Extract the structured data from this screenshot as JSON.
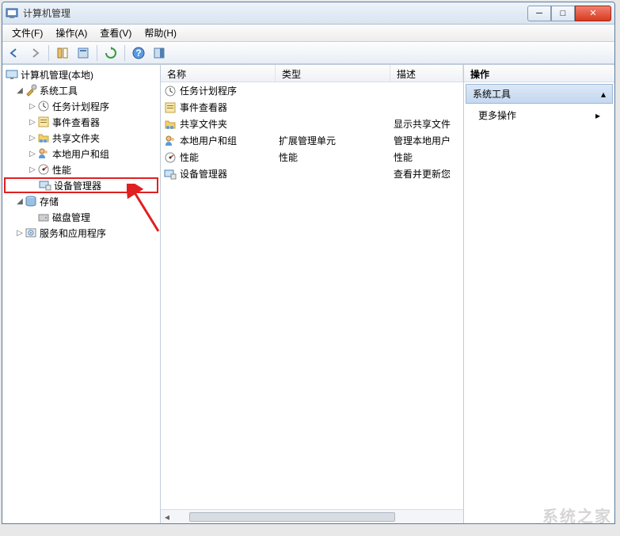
{
  "window": {
    "title": "计算机管理"
  },
  "menu": {
    "file": "文件(F)",
    "action": "操作(A)",
    "view": "查看(V)",
    "help": "帮助(H)"
  },
  "tree": {
    "root": "计算机管理(本地)",
    "sys_tools": "系统工具",
    "task_sched": "任务计划程序",
    "event_viewer": "事件查看器",
    "shared": "共享文件夹",
    "local_users": "本地用户和组",
    "perf": "性能",
    "device_mgr": "设备管理器",
    "storage": "存储",
    "disk_mgmt": "磁盘管理",
    "services": "服务和应用程序"
  },
  "list": {
    "cols": {
      "name": "名称",
      "type": "类型",
      "desc": "描述"
    },
    "col_widths": {
      "name": 145,
      "type": 145,
      "desc": 90
    },
    "rows": [
      {
        "icon": "clock",
        "name": "任务计划程序",
        "type": "",
        "desc": ""
      },
      {
        "icon": "event",
        "name": "事件查看器",
        "type": "",
        "desc": ""
      },
      {
        "icon": "folder",
        "name": "共享文件夹",
        "type": "",
        "desc": "显示共享文件"
      },
      {
        "icon": "users",
        "name": "本地用户和组",
        "type": "扩展管理单元",
        "desc": "管理本地用户"
      },
      {
        "icon": "perf",
        "name": "性能",
        "type": "性能",
        "desc": "性能"
      },
      {
        "icon": "device",
        "name": "设备管理器",
        "type": "",
        "desc": "查看并更新您"
      }
    ]
  },
  "actions": {
    "title": "操作",
    "selected": "系统工具",
    "more": "更多操作"
  },
  "watermark": "系统之家"
}
